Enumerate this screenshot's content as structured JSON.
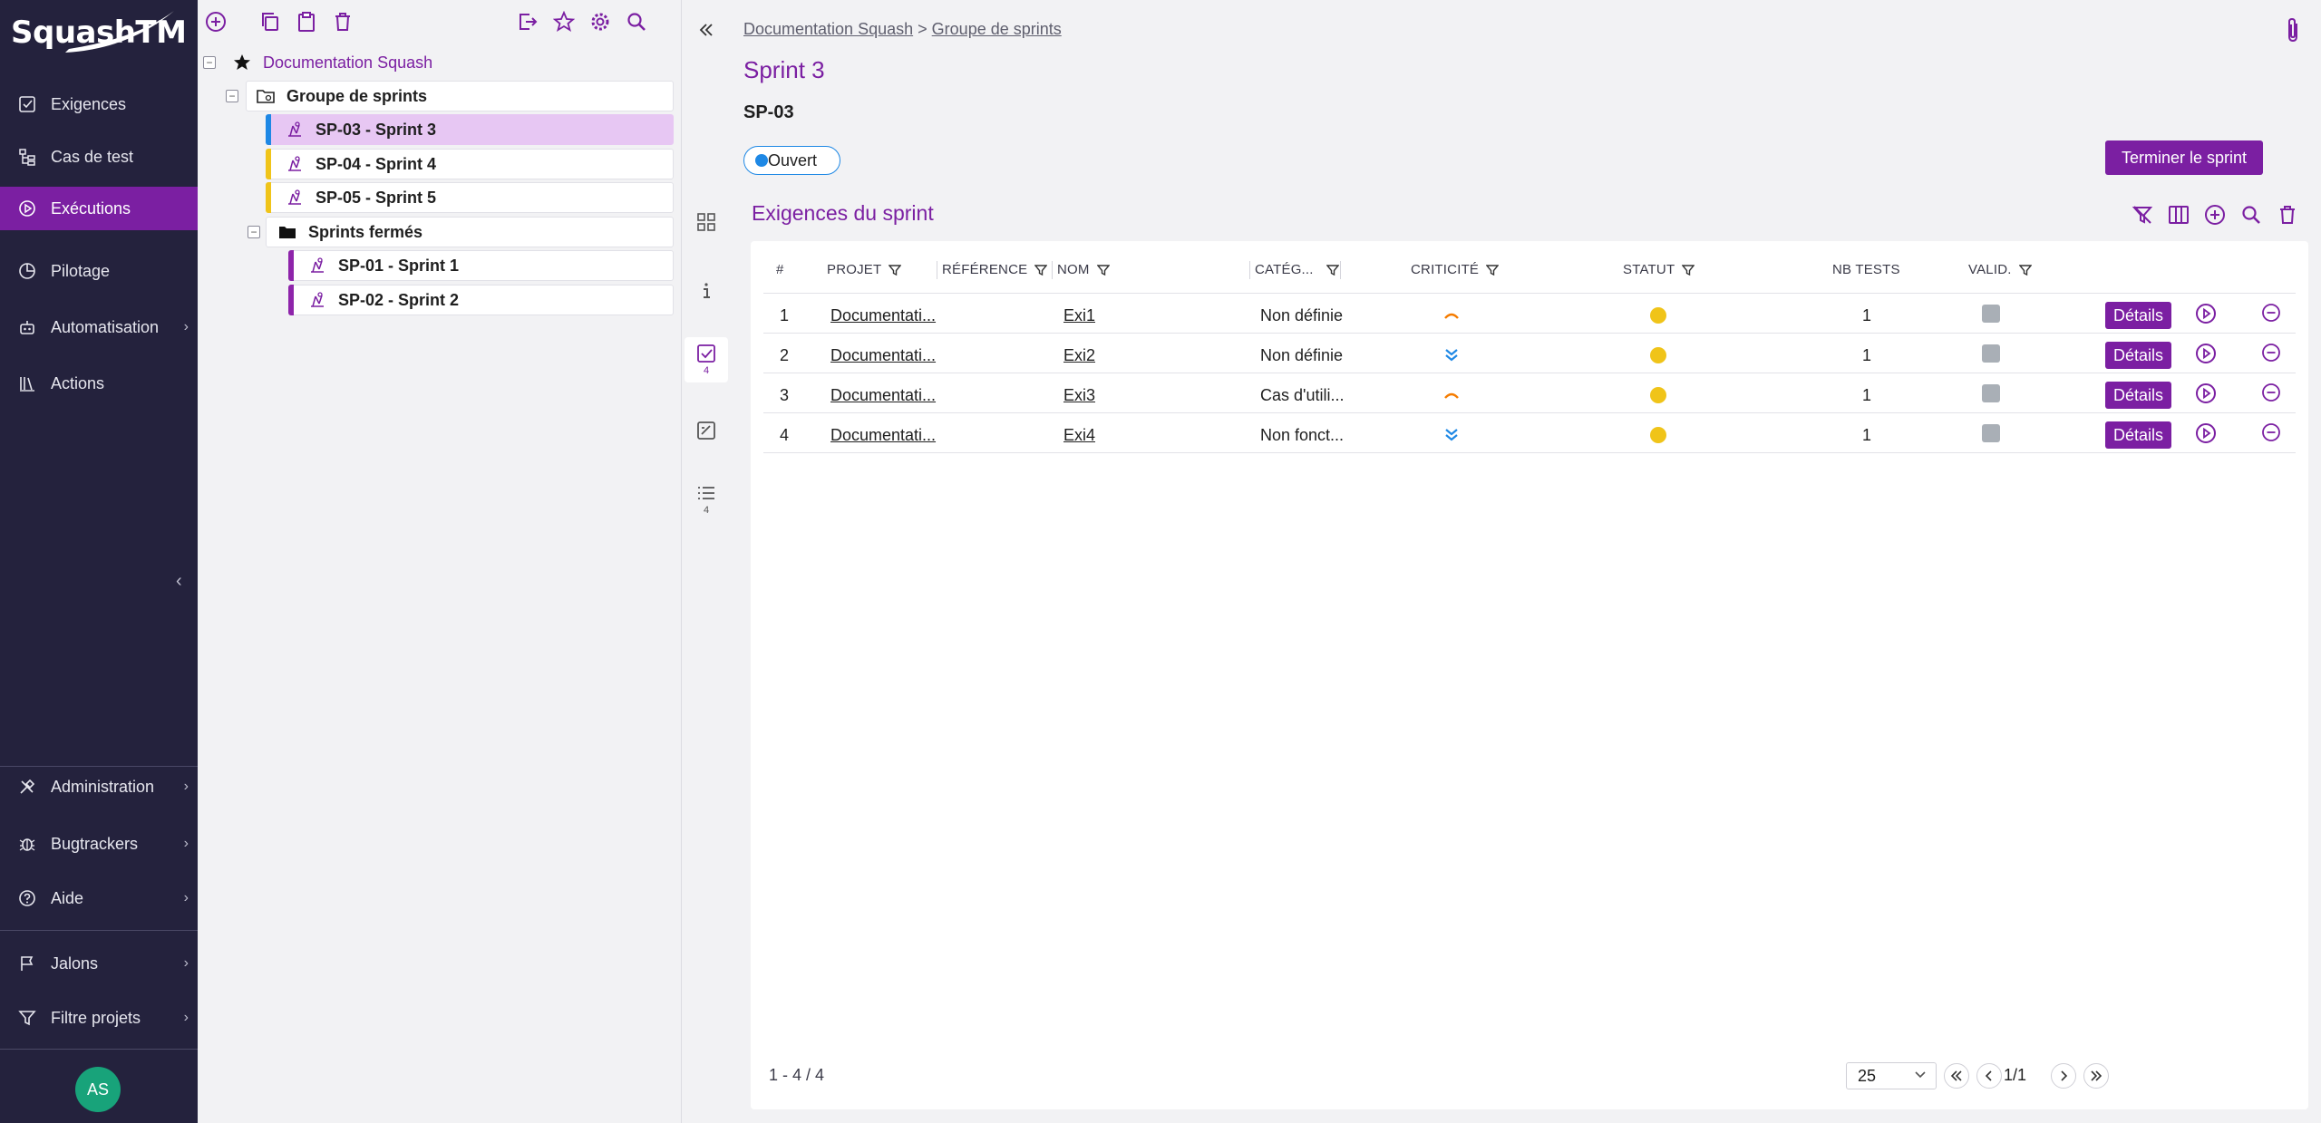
{
  "app": {
    "logo_text": "SquashTM"
  },
  "sidebar": {
    "items": [
      {
        "label": "Exigences",
        "icon": "checkbox-icon"
      },
      {
        "label": "Cas de test",
        "icon": "tree-icon"
      },
      {
        "label": "Exécutions",
        "icon": "play-circle-icon",
        "active": true
      },
      {
        "label": "Pilotage",
        "icon": "pie-chart-icon"
      },
      {
        "label": "Automatisation",
        "icon": "robot-icon"
      },
      {
        "label": "Actions",
        "icon": "library-icon"
      }
    ],
    "bottom_items": [
      {
        "label": "Administration",
        "icon": "tools-icon"
      },
      {
        "label": "Bugtrackers",
        "icon": "bug-icon"
      },
      {
        "label": "Aide",
        "icon": "help-icon"
      },
      {
        "label": "Jalons",
        "icon": "flag-icon"
      },
      {
        "label": "Filtre projets",
        "icon": "filter-icon"
      }
    ],
    "avatar_initials": "AS"
  },
  "tree": {
    "project": "Documentation Squash",
    "group": "Groupe de sprints",
    "sprints": [
      {
        "label": "SP-03 - Sprint 3",
        "color": "#1e88e5",
        "selected": true
      },
      {
        "label": "SP-04 - Sprint 4",
        "color": "#f0c419"
      },
      {
        "label": "SP-05 - Sprint 5",
        "color": "#f0c419"
      }
    ],
    "closed_folder": "Sprints fermés",
    "closed_sprints": [
      {
        "label": "SP-01 - Sprint 1",
        "color": "#8e24aa"
      },
      {
        "label": "SP-02 - Sprint 2",
        "color": "#8e24aa"
      }
    ]
  },
  "vtabs": {
    "requirements_count": "4",
    "list_count": "4"
  },
  "main": {
    "breadcrumb": [
      "Documentation Squash",
      "Groupe de sprints"
    ],
    "breadcrumb_sep": ">",
    "title": "Sprint 3",
    "reference": "SP-03",
    "status": "Ouvert",
    "end_button": "Terminer le sprint",
    "section_title": "Exigences du sprint"
  },
  "table": {
    "headers": {
      "num": "#",
      "project": "PROJET",
      "reference": "RÉFÉRENCE",
      "name": "NOM",
      "category": "CATÉG...",
      "criticality": "CRITICITÉ",
      "status": "STATUT",
      "nb_tests": "NB TESTS",
      "validation": "VALID."
    },
    "rows": [
      {
        "num": "1",
        "project": "Documentati...",
        "reference": "",
        "name": "Exi1",
        "category": "Non définie",
        "criticality": "major",
        "nb_tests": "1",
        "details": "Détails"
      },
      {
        "num": "2",
        "project": "Documentati...",
        "reference": "",
        "name": "Exi2",
        "category": "Non définie",
        "criticality": "minor",
        "nb_tests": "1",
        "details": "Détails"
      },
      {
        "num": "3",
        "project": "Documentati...",
        "reference": "",
        "name": "Exi3",
        "category": "Cas d'utili...",
        "criticality": "major",
        "nb_tests": "1",
        "details": "Détails"
      },
      {
        "num": "4",
        "project": "Documentati...",
        "reference": "",
        "name": "Exi4",
        "category": "Non fonct...",
        "criticality": "minor",
        "nb_tests": "1",
        "details": "Détails"
      }
    ],
    "pagination_summary": "1 - 4 / 4",
    "page_size": "25",
    "page_label": "1/1"
  },
  "colors": {
    "accent": "#7b1fa2",
    "sidebar_bg": "#24223d",
    "status_open": "#1e88e5",
    "status_dot": "#f0c419",
    "major": "#f57c00",
    "minor": "#1e88e5"
  }
}
